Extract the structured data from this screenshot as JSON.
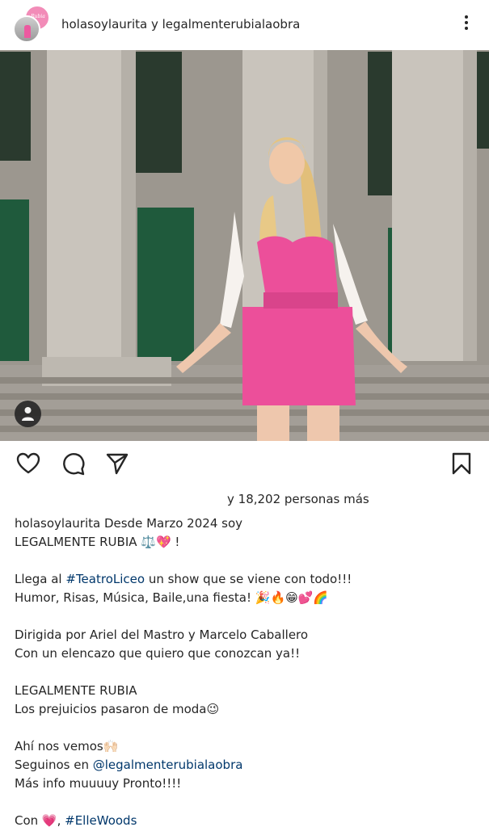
{
  "post": {
    "username_line": "holasoylaurita y legalmenterubialaobra",
    "avatar_badge": "Rubia",
    "likes_text": "y 18,202 personas más"
  },
  "caption": {
    "lines": [
      {
        "parts": [
          {
            "text": "holasoylaurita"
          },
          {
            "text": " Desde Marzo 2024 soy"
          }
        ]
      },
      {
        "parts": [
          {
            "text": "LEGALMENTE RUBIA ⚖️💖 !"
          }
        ]
      },
      {
        "gap": true
      },
      {
        "parts": [
          {
            "text": "Llega al "
          },
          {
            "text": "#TeatroLiceo",
            "link": true
          },
          {
            "text": " un show que se viene con todo!!!"
          }
        ]
      },
      {
        "parts": [
          {
            "text": "Humor, Risas, Música, Baile,una fiesta! 🎉🔥😁💕🌈"
          }
        ]
      },
      {
        "gap": true
      },
      {
        "parts": [
          {
            "text": "Dirigida por Ariel del Mastro y Marcelo Caballero"
          }
        ]
      },
      {
        "parts": [
          {
            "text": "Con un elencazo que quiero que conozcan ya!!"
          }
        ]
      },
      {
        "gap": true
      },
      {
        "parts": [
          {
            "text": "LEGALMENTE RUBIA"
          }
        ]
      },
      {
        "parts": [
          {
            "text": "Los prejuicios pasaron de moda😉"
          }
        ]
      },
      {
        "gap": true
      },
      {
        "parts": [
          {
            "text": "Ahí nos vemos🙌🏻"
          }
        ]
      },
      {
        "parts": [
          {
            "text": "Seguinos en "
          },
          {
            "text": "@legalmenterubialaobra",
            "link": true
          }
        ]
      },
      {
        "parts": [
          {
            "text": "Más info muuuuy Pronto!!!!"
          }
        ]
      },
      {
        "gap": true
      },
      {
        "parts": [
          {
            "text": "Con 💗, "
          },
          {
            "text": "#ElleWoods",
            "link": true
          }
        ]
      }
    ]
  },
  "icons": {
    "more": "more-options-icon",
    "like": "heart-icon",
    "comment": "comment-icon",
    "share": "send-icon",
    "save": "bookmark-icon",
    "tag": "user-tag-icon"
  },
  "colors": {
    "text": "#262626",
    "link": "#00376b",
    "dress": "#ec4f9a"
  }
}
